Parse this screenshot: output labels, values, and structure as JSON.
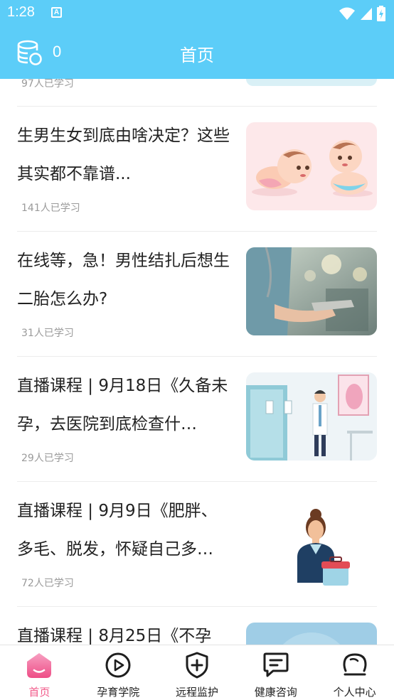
{
  "status_bar": {
    "time": "1:28",
    "notification_badge": "A"
  },
  "header": {
    "coin_count": "0",
    "title": "首页"
  },
  "partial_article": {
    "learners": "97人已学习"
  },
  "articles": [
    {
      "title": "生男生女到底由啥决定？这些其实都不靠谱...",
      "learners": "141人已学习",
      "thumb": "babies-illustration"
    },
    {
      "title": "在线等，急！男性结扎后想生二胎怎么办?",
      "learners": "31人已学习",
      "thumb": "doctor-tablet-photo"
    },
    {
      "title": "直播课程 | 9月18日《久备未孕，去医院到底检查什…",
      "learners": "29人已学习",
      "thumb": "clinic-doctor-illustration"
    },
    {
      "title": "直播课程 | 9月9日《肥胖、多毛、脱发，怀疑自己多…",
      "learners": "72人已学习",
      "thumb": "nurse-illustration"
    },
    {
      "title": "直播课程 | 8月25日《不孕",
      "learners": "",
      "thumb": "blue-circle-illustration"
    }
  ],
  "tabbar": {
    "items": [
      {
        "label": "首页",
        "icon": "home-icon",
        "active": true
      },
      {
        "label": "孕育学院",
        "icon": "play-circle-icon",
        "active": false
      },
      {
        "label": "远程监护",
        "icon": "shield-plus-icon",
        "active": false
      },
      {
        "label": "健康咨询",
        "icon": "chat-bubble-icon",
        "active": false
      },
      {
        "label": "个人中心",
        "icon": "profile-circle-icon",
        "active": false
      }
    ]
  },
  "colors": {
    "header": "#5ccdf8",
    "active_tab": "#f25a8a",
    "meta_text": "#9a9a9a",
    "title_text": "#222222"
  }
}
